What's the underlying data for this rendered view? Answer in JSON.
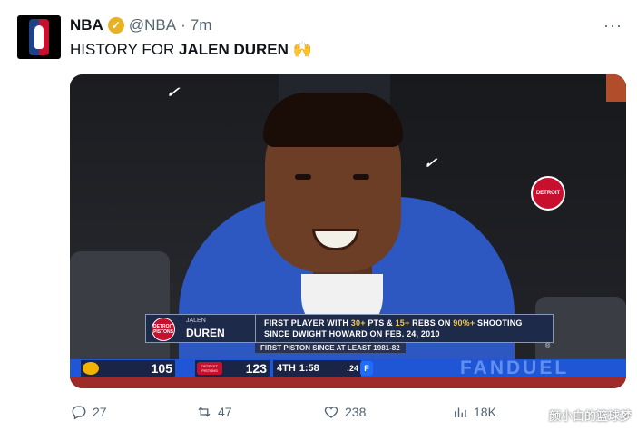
{
  "tweet": {
    "author_name": "NBA",
    "handle": "@NBA",
    "separator": "·",
    "time": "7m",
    "more_label": "···",
    "text_prefix": "HISTORY FOR ",
    "text_bold": "JALEN DUREN",
    "emoji": "🙌"
  },
  "broadcast": {
    "team_logo_label": "DETROIT PISTONS",
    "first_name": "JALEN",
    "last_name": "DUREN",
    "line1_a": "FIRST PLAYER WITH ",
    "line1_b": "30+",
    "line1_c": " PTS & ",
    "line1_d": "15+",
    "line1_e": " REBS ON ",
    "line1_f": "90%+",
    "line1_g": " SHOOTING",
    "line2": "SINCE DWIGHT HOWARD ON FEB. 24, 2010",
    "subtag": "FIRST PISTON SINCE AT LEAST 1981-82",
    "copyright": "®",
    "jersey_patch": "DETROIT",
    "away_score": "105",
    "home_label": "DETROIT PISTONS",
    "home_score": "123",
    "quarter": "4TH",
    "clock": "1:58",
    "shot_clock": ":24",
    "sponsor_bg": "FANDUEL"
  },
  "actions": {
    "replies": "27",
    "reposts": "47",
    "likes": "238",
    "views": "18K"
  },
  "watermark": "颜小白的篮球梦",
  "colors": {
    "pistons_red": "#c8102e",
    "pistons_blue": "#1d428a",
    "verified_gold": "#e8b222",
    "highlight_gold": "#f0c84a"
  }
}
